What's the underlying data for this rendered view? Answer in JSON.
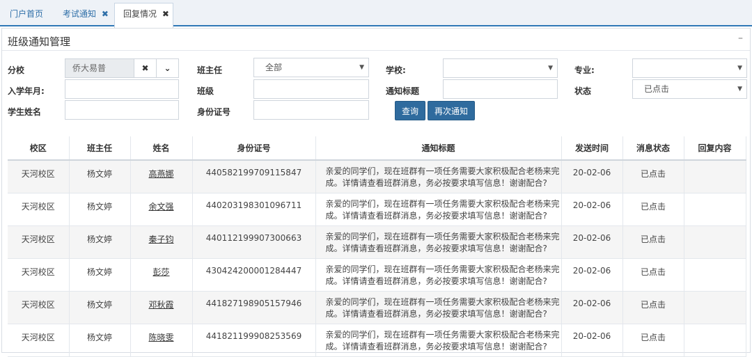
{
  "tabs": [
    {
      "label": "门户首页"
    },
    {
      "label": "考试通知",
      "close": "✖"
    },
    {
      "label": "回复情况",
      "close": "✖"
    }
  ],
  "panel": {
    "title": "班级通知管理",
    "collapse": "–"
  },
  "form": {
    "branch_label": "分校",
    "branch_value": "侨大易普",
    "clear_icon": "✖",
    "dropdown_icon": "⌄",
    "teacher_label": "班主任",
    "teacher_value": "全部",
    "school_label": "学校:",
    "school_value": "",
    "major_label": "专业:",
    "major_value": "",
    "enroll_label": "入学年月:",
    "enroll_value": "",
    "class_label": "班级",
    "class_value": "",
    "notice_title_label": "通知标题",
    "notice_title_value": "",
    "status_label": "状态",
    "status_value": "已点击",
    "student_label": "学生姓名",
    "student_value": "",
    "idcard_label": "身份证号",
    "idcard_value": "",
    "query_button": "查询",
    "renotify_button": "再次通知",
    "select_arrow": "▼"
  },
  "table": {
    "headers": [
      "校区",
      "班主任",
      "姓名",
      "身份证号",
      "通知标题",
      "发送时间",
      "消息状态",
      "回复内容"
    ],
    "rows": [
      {
        "campus": "天河校区",
        "teacher": "杨文婷",
        "name": "高燕娜",
        "id": "440582199709115847",
        "title": "亲爱的同学们，现在班群有一项任务需要大家积极配合老杨来完成。详情请查看班群消息，务必按要求填写信息！谢谢配合?",
        "time": "20-02-06",
        "status": "已点击",
        "reply": ""
      },
      {
        "campus": "天河校区",
        "teacher": "杨文婷",
        "name": "余文强",
        "id": "440203198301096711",
        "title": "亲爱的同学们，现在班群有一项任务需要大家积极配合老杨来完成。详情请查看班群消息，务必按要求填写信息！谢谢配合?",
        "time": "20-02-06",
        "status": "已点击",
        "reply": ""
      },
      {
        "campus": "天河校区",
        "teacher": "杨文婷",
        "name": "秦子钧",
        "id": "440112199907300663",
        "title": "亲爱的同学们，现在班群有一项任务需要大家积极配合老杨来完成。详情请查看班群消息，务必按要求填写信息！谢谢配合?",
        "time": "20-02-06",
        "status": "已点击",
        "reply": ""
      },
      {
        "campus": "天河校区",
        "teacher": "杨文婷",
        "name": "彭莎",
        "id": "430424200001284447",
        "title": "亲爱的同学们，现在班群有一项任务需要大家积极配合老杨来完成。详情请查看班群消息，务必按要求填写信息！谢谢配合?",
        "time": "20-02-06",
        "status": "已点击",
        "reply": ""
      },
      {
        "campus": "天河校区",
        "teacher": "杨文婷",
        "name": "邓秋霞",
        "id": "441827198905157946",
        "title": "亲爱的同学们，现在班群有一项任务需要大家积极配合老杨来完成。详情请查看班群消息，务必按要求填写信息！谢谢配合?",
        "time": "20-02-06",
        "status": "已点击",
        "reply": ""
      },
      {
        "campus": "天河校区",
        "teacher": "杨文婷",
        "name": "陈晓雯",
        "id": "441821199908253569",
        "title": "亲爱的同学们，现在班群有一项任务需要大家积极配合老杨来完成。详情请查看班群消息，务必按要求填写信息！谢谢配合?",
        "time": "20-02-06",
        "status": "已点击",
        "reply": ""
      }
    ]
  }
}
